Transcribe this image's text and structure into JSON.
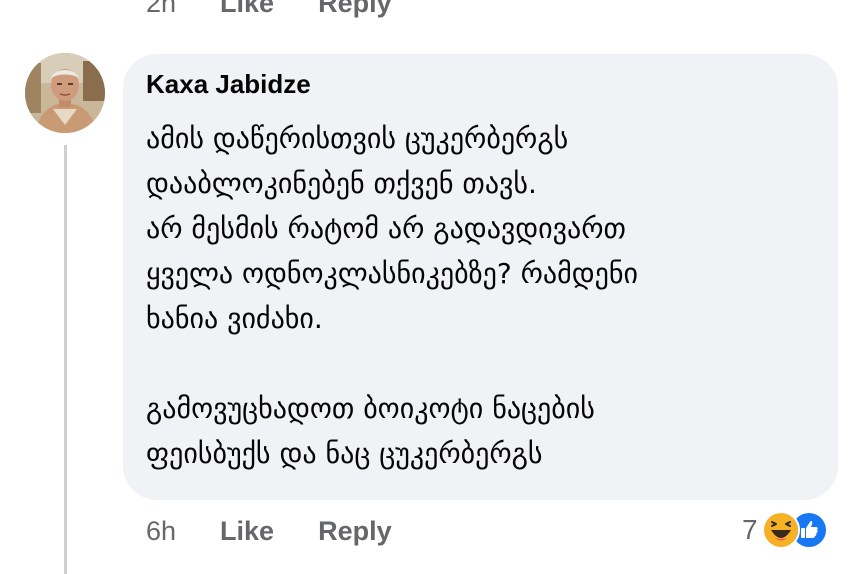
{
  "previous_comment": {
    "time": "2h",
    "like_label": "Like",
    "reply_label": "Reply"
  },
  "comment": {
    "author": "Kaxa Jabidze",
    "lines": [
      "ამის დაწერისთვის ცუკერბერგს",
      "დააბლოკინებენ თქვენ თავს.",
      "არ მესმის რატომ არ გადავდივართ",
      "ყველა ოდნოკლასნიკებზე?  რამდენი",
      "ხანია ვიძახი.",
      "",
      "გამოვუცხადოთ ბოიკოტი ნაცების",
      "ფეისბუქს და ნაც ცუკერბერგს"
    ],
    "time": "6h",
    "like_label": "Like",
    "reply_label": "Reply",
    "reaction_count": "7",
    "reaction_icons": [
      "haha-icon",
      "like-icon"
    ]
  },
  "colors": {
    "bubble": "#f0f2f5",
    "meta_text": "#65676b",
    "thread_line": "#ced0d4",
    "like_blue": "#1877f2",
    "haha_yellow": "#f7b125"
  }
}
